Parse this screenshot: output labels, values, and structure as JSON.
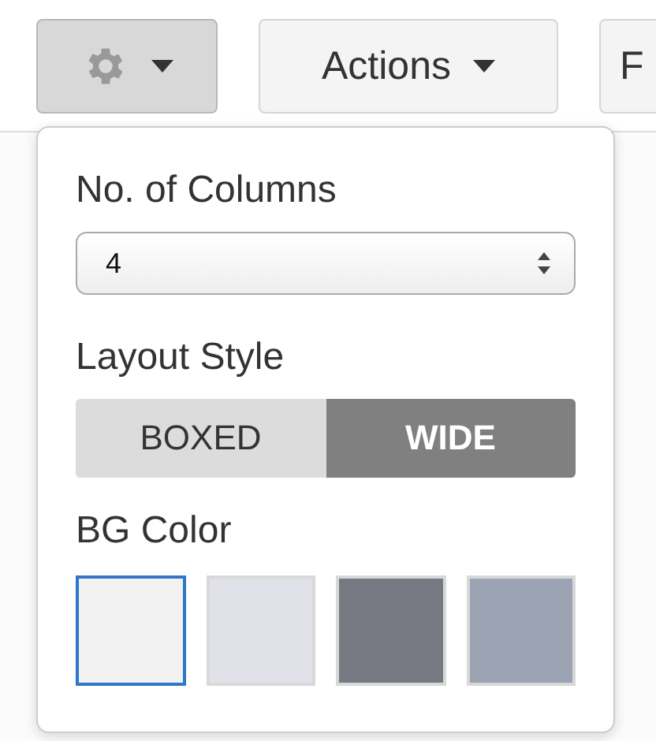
{
  "toolbar": [
    {
      "kind": "gear",
      "selected": true
    },
    {
      "kind": "dropdown",
      "label": "Actions",
      "selected": false
    },
    {
      "kind": "text",
      "label": "F",
      "selected": false
    }
  ],
  "panel": {
    "columns": {
      "label": "No. of Columns",
      "value": "4"
    },
    "layout": {
      "label": "Layout Style",
      "options": [
        {
          "label": "BOXED",
          "selected": false
        },
        {
          "label": "WIDE",
          "selected": true
        }
      ]
    },
    "bg": {
      "label": "BG Color",
      "swatches": [
        {
          "color": "#f2f2f2",
          "selected": true
        },
        {
          "color": "#e1e2e9",
          "selected": false
        },
        {
          "color": "#777a82",
          "selected": false
        },
        {
          "color": "#9ca3b3",
          "selected": false
        }
      ]
    }
  }
}
